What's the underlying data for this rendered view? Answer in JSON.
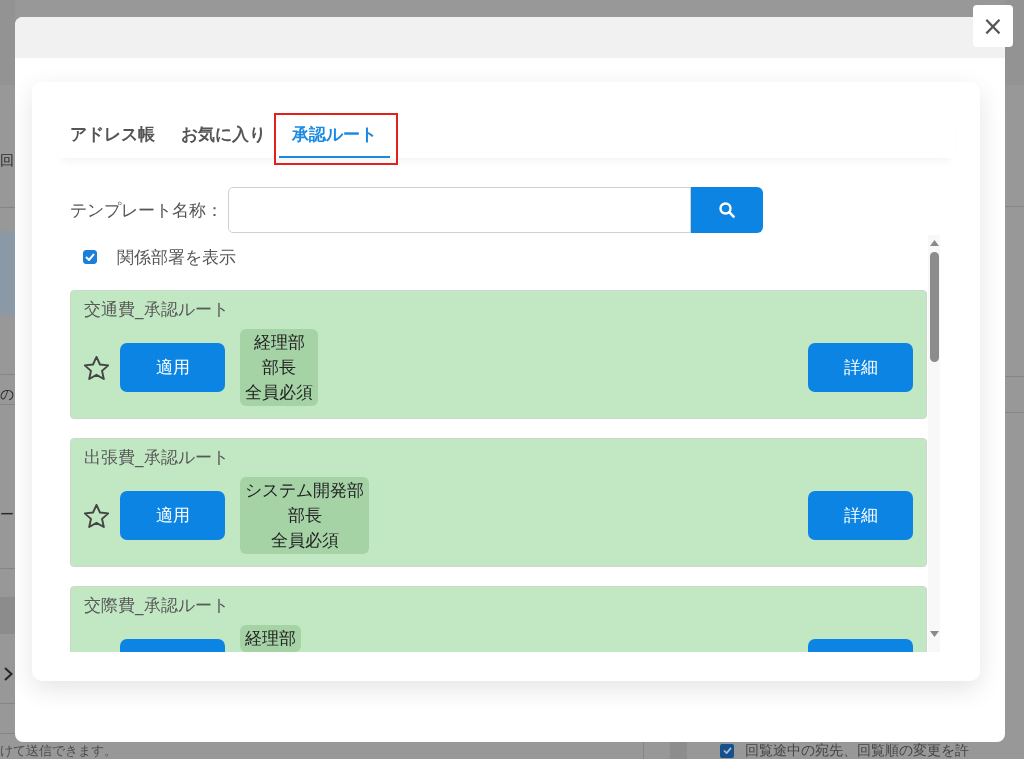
{
  "background": {
    "side_texts": [
      "回",
      "の",
      "ー"
    ],
    "footer_note": "けて送信できます。",
    "option": {
      "label": "回覧途中の宛先、回覧順の変更を許",
      "checked": true
    }
  },
  "dialog": {
    "close": "×",
    "tabs": [
      {
        "label": "アドレス帳",
        "selected": false,
        "highlighted": false
      },
      {
        "label": "お気に入り",
        "selected": false,
        "highlighted": false
      },
      {
        "label": "承認ルート",
        "selected": true,
        "highlighted": true
      }
    ],
    "search": {
      "label": "テンプレート名称："
    },
    "show_related": {
      "label": "関係部署を表示",
      "checked": true
    },
    "routes": [
      {
        "title": "交通費_承認ルート",
        "favorite": false,
        "apply_label": "適用",
        "approvers": [
          "経理部",
          "部長",
          "全員必須"
        ],
        "detail_label": "詳細"
      },
      {
        "title": "出張費_承認ルート",
        "favorite": false,
        "apply_label": "適用",
        "approvers": [
          "システム開発部",
          "部長",
          "全員必須"
        ],
        "detail_label": "詳細"
      },
      {
        "title": "交際費_承認ルート",
        "approvers": [
          "経理部"
        ]
      }
    ]
  }
}
